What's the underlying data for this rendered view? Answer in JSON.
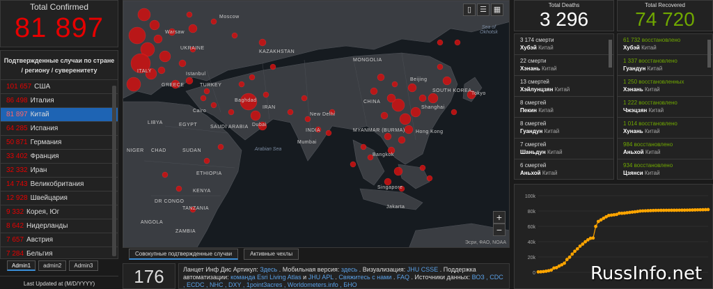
{
  "total": {
    "label": "Total Confirmed",
    "value": "81 897"
  },
  "countries": {
    "header": "Подтвержденные случаи по стране / региону / суверенитету",
    "items": [
      {
        "value": "101 657",
        "name": "США"
      },
      {
        "value": "86 498",
        "name": "Италия"
      },
      {
        "value": "81 897",
        "name": "Китай",
        "selected": true
      },
      {
        "value": "64 285",
        "name": "Испания"
      },
      {
        "value": "50 871",
        "name": "Германия"
      },
      {
        "value": "33 402",
        "name": "Франция"
      },
      {
        "value": "32 332",
        "name": "Иран"
      },
      {
        "value": "14 743",
        "name": "Великобритания"
      },
      {
        "value": "12 928",
        "name": "Швейцария"
      },
      {
        "value": "9 332",
        "name": "Корея, Юг"
      },
      {
        "value": "8 642",
        "name": "Нидерланды"
      },
      {
        "value": "7 657",
        "name": "Австрия"
      },
      {
        "value": "7 284",
        "name": "Бельгия"
      }
    ]
  },
  "admin_tabs": [
    "Admin1",
    "admin2",
    "Admin3"
  ],
  "last_updated": "Last Updated at (M/D/YYYY)",
  "map": {
    "labels": {
      "moscow": "Moscow",
      "warsaw": "Warsaw",
      "ukraine": "UKRAINE",
      "kazakhstan": "KAZAKHSTAN",
      "mongolia": "MONGOLIA",
      "istanbul": "Istanbul",
      "turkey": "TURKEY",
      "greece": "GREECE",
      "italy": "ITALY",
      "baghdad": "Baghdad",
      "iran": "IRAN",
      "cairo": "Cairo",
      "egypt": "EGYPT",
      "libya": "LIBYA",
      "saudi": "SAUDI ARABIA",
      "dubai": "Dubai",
      "newdelhi": "New Delhi",
      "india": "INDIA",
      "mumbai": "Mumbai",
      "china": "CHINA",
      "beijing": "Beijing",
      "shanghai": "Shanghai",
      "southkorea": "SOUTH KOREA",
      "tokyo": "Tokyo",
      "hongkong": "Hong Kong",
      "myanmar": "MYANMAR (BURMA)",
      "bangkok": "Bangkok",
      "singapore": "Singapore",
      "jakarta": "Jakarta",
      "sudan": "SUDAN",
      "chad": "CHAD",
      "niger": "NIGER",
      "ethiopia": "ETHIOPIA",
      "kenya": "KENYA",
      "tanzania": "TANZANIA",
      "drcongo": "DR CONGO",
      "angola": "ANGOLA",
      "zambia": "ZAMBIA",
      "arabian_sea": "Arabian Sea",
      "sea_okhotsk": "Sea of Okhotsk"
    },
    "attribution": "Эсри, ФАО, NOAA",
    "zoom_in": "+",
    "zoom_out": "−"
  },
  "map_tabs": [
    "Совокупные подтвержденные случаи",
    "Активные чехлы"
  ],
  "count_box": "176",
  "info": {
    "t1": "Ланцет Инф Дис Артикул:",
    "l1": "Здесь",
    "t2": ". Мобильная версия:",
    "l2": "здесь",
    "t3": ". Визуализация:",
    "l3": "JHU CSSE",
    "t4": ". Поддержка автоматизации:",
    "l4": "команда Esri Living Atlas",
    "t5": "и",
    "l5": "JHU APL",
    "t6": ".",
    "l6": "Свяжитесь с нами",
    "t7": ".",
    "l7": "FAQ",
    "t8": ". Источники данных:",
    "l8": "ВОЗ , CDC , ECDC , NHC , DXY , 1point3acres , Worldometers.info , БНО"
  },
  "deaths": {
    "label": "Total Deaths",
    "value": "3 296",
    "items": [
      {
        "value": "3 174",
        "unit": "смерти",
        "place": "Хубэй",
        "country": "Китай"
      },
      {
        "value": "22",
        "unit": "смерти",
        "place": "Хэнань",
        "country": "Китай"
      },
      {
        "value": "13",
        "unit": "смертей",
        "place": "Хэйлунцзян",
        "country": "Китай"
      },
      {
        "value": "8",
        "unit": "смертей",
        "place": "Пекин",
        "country": "Китай"
      },
      {
        "value": "8",
        "unit": "смертей",
        "place": "Гуандун",
        "country": "Китай"
      },
      {
        "value": "7",
        "unit": "смертей",
        "place": "Шаньдун",
        "country": "Китай"
      },
      {
        "value": "6",
        "unit": "смертей",
        "place": "Аньхой",
        "country": "Китай"
      }
    ]
  },
  "recovered": {
    "label": "Total Recovered",
    "value": "74 720",
    "items": [
      {
        "value": "61 732",
        "unit": "восстановлено",
        "place": "Хубэй",
        "country": "Китай"
      },
      {
        "value": "1 337",
        "unit": "восстановлено",
        "place": "Гуандун",
        "country": "Китай"
      },
      {
        "value": "1 250",
        "unit": "восстановленных",
        "place": "Хэнань",
        "country": "Китай"
      },
      {
        "value": "1 222",
        "unit": "восстановлено",
        "place": "Чжэцзян",
        "country": "Китай"
      },
      {
        "value": "1 014",
        "unit": "восстановлено",
        "place": "Хунань",
        "country": "Китай"
      },
      {
        "value": "984",
        "unit": "восстановлено",
        "place": "Аньхой",
        "country": "Китай"
      },
      {
        "value": "934",
        "unit": "восстановлено",
        "place": "Цзянси",
        "country": "Китай"
      }
    ]
  },
  "chart_data": {
    "type": "line",
    "title": "",
    "xlabel": "",
    "ylabel": "",
    "ylim": [
      0,
      100000
    ],
    "yticks": [
      "0",
      "20k",
      "40k",
      "60k",
      "80k",
      "100k"
    ],
    "ytick_values": [
      0,
      20000,
      40000,
      60000,
      80000,
      100000
    ],
    "series_color": "#ffa500",
    "values": [
      548,
      643,
      920,
      1406,
      2075,
      2877,
      5509,
      6087,
      8141,
      9802,
      11891,
      16630,
      19716,
      23707,
      27440,
      30587,
      34110,
      36814,
      39829,
      42354,
      44386,
      44759,
      59895,
      66358,
      68413,
      70513,
      72434,
      74211,
      74619,
      75077,
      75550,
      77001,
      77022,
      77241,
      77754,
      78166,
      78600,
      78928,
      79356,
      79932,
      80136,
      80261,
      80386,
      80537,
      80690,
      80770,
      80823,
      80860,
      80887,
      80921,
      80932,
      80945,
      80977,
      81003,
      81033,
      81058,
      81102,
      81156,
      81250,
      81305,
      81435,
      81498,
      81591,
      81661,
      81782,
      81897
    ]
  },
  "watermark": "RussInfo.net",
  "colors": {
    "red": "#e60000",
    "green": "#70a800",
    "accent": "#1e64b4",
    "orange": "#ffa500"
  }
}
